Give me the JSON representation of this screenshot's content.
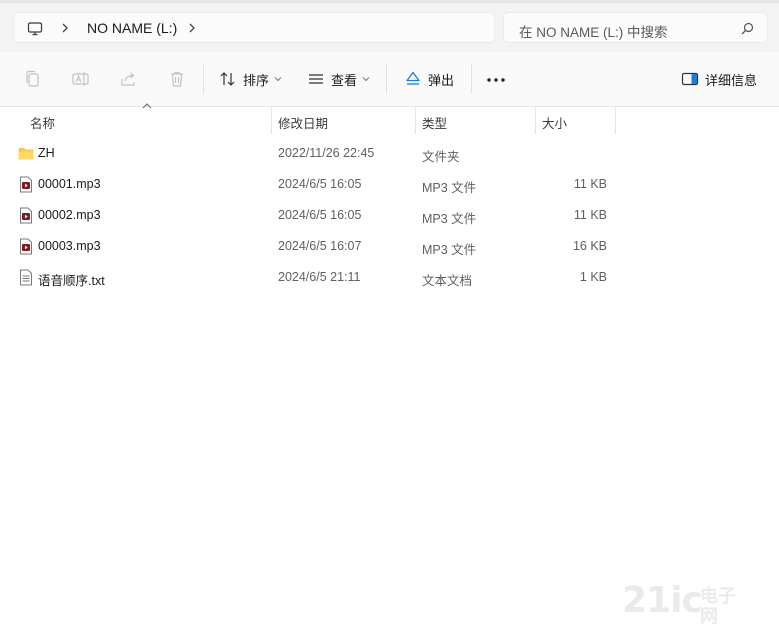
{
  "address_bar": {
    "location": "NO NAME (L:)",
    "search_placeholder": "在 NO NAME (L:) 中搜索"
  },
  "command_bar": {
    "sort_label": "排序",
    "view_label": "查看",
    "eject_label": "弹出",
    "details_label": "详细信息"
  },
  "columns": {
    "name": "名称",
    "date": "修改日期",
    "type": "类型",
    "size": "大小"
  },
  "files": [
    {
      "name": "ZH",
      "date": "2022/11/26 22:45",
      "type": "文件夹",
      "size": "",
      "icon": "folder-icon"
    },
    {
      "name": "00001.mp3",
      "date": "2024/6/5 16:05",
      "type": "MP3 文件",
      "size": "11 KB",
      "icon": "mp3-file-icon"
    },
    {
      "name": "00002.mp3",
      "date": "2024/6/5 16:05",
      "type": "MP3 文件",
      "size": "11 KB",
      "icon": "mp3-file-icon"
    },
    {
      "name": "00003.mp3",
      "date": "2024/6/5 16:07",
      "type": "MP3 文件",
      "size": "16 KB",
      "icon": "mp3-file-icon"
    },
    {
      "name": "语音顺序.txt",
      "date": "2024/6/5 21:11",
      "type": "文本文档",
      "size": "1 KB",
      "icon": "text-file-icon"
    }
  ],
  "watermark": {
    "logo": "21ic",
    "text1": "电子",
    "text2": "网"
  }
}
